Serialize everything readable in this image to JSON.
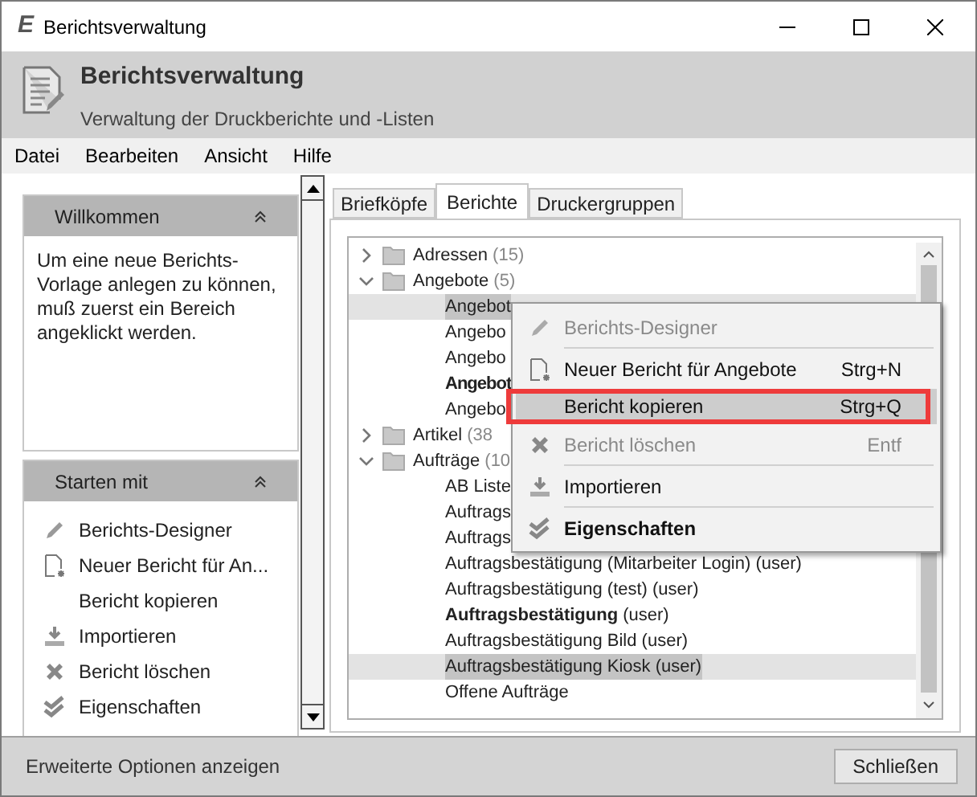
{
  "window": {
    "logo": "E",
    "title": "Berichtsverwaltung"
  },
  "header": {
    "title": "Berichtsverwaltung",
    "subtitle": "Verwaltung der Druckberichte und -Listen"
  },
  "menu_bar": [
    "Datei",
    "Bearbeiten",
    "Ansicht",
    "Hilfe"
  ],
  "sidebar": {
    "welcome": {
      "title": "Willkommen",
      "text": "Um eine neue Berichts-Vorlage anlegen zu können, muß zuerst ein Bereich angeklickt werden."
    },
    "start": {
      "title": "Starten mit",
      "items": [
        {
          "label": "Berichts-Designer"
        },
        {
          "label": "Neuer Bericht für An..."
        },
        {
          "label": "Bericht kopieren"
        },
        {
          "label": "Importieren"
        },
        {
          "label": "Bericht löschen"
        },
        {
          "label": "Eigenschaften"
        }
      ]
    }
  },
  "tabs": [
    {
      "label": "Briefköpfe",
      "selected": false
    },
    {
      "label": "Berichte",
      "selected": true
    },
    {
      "label": "Druckergruppen",
      "selected": false
    }
  ],
  "tree": [
    {
      "label": "Adressen",
      "count": "(15)",
      "expanded": false
    },
    {
      "label": "Angebote",
      "count": "(5)",
      "expanded": true,
      "children": [
        {
          "label": "Angebot",
          "selected": true,
          "bold": false
        },
        {
          "label": "Angebo",
          "selected": false,
          "bold": false
        },
        {
          "label": "Angebo",
          "selected": false,
          "bold": false
        },
        {
          "label": "Angebot",
          "selected": false,
          "bold": true
        },
        {
          "label": "Angebo",
          "selected": false,
          "bold": false
        }
      ]
    },
    {
      "label": "Artikel",
      "count": "(38",
      "expanded": false
    },
    {
      "label": "Aufträge",
      "count": "(10",
      "expanded": true,
      "children": [
        {
          "label": "AB Liste",
          "selected": false,
          "bold": false
        },
        {
          "label": "Auftrags",
          "selected": false,
          "bold": false
        },
        {
          "label": "Auftrags",
          "selected": false,
          "bold": false
        },
        {
          "label": "Auftragsbestätigung (Mitarbeiter Login) (user)",
          "selected": false,
          "bold": false
        },
        {
          "label": "Auftragsbestätigung (test) (user)",
          "selected": false,
          "bold": false
        },
        {
          "label": "**Auftragsbestätigung** (user)",
          "selected": false,
          "bold": false
        },
        {
          "label": "Auftragsbestätigung Bild (user)",
          "selected": false,
          "bold": false
        },
        {
          "label": "Auftragsbestätigung Kiosk (user)",
          "selected": true,
          "bold": false
        },
        {
          "label": "Offene Aufträge",
          "selected": false,
          "bold": false
        }
      ]
    }
  ],
  "context_menu": [
    {
      "label": "Berichts-Designer",
      "disabled": true,
      "selected": false,
      "bold": false
    },
    {
      "label": "Neuer Bericht für Angebote",
      "shortcut": "Strg+N",
      "disabled": false,
      "selected": false,
      "bold": false
    },
    {
      "label": "Bericht kopieren",
      "shortcut": "Strg+Q",
      "disabled": false,
      "selected": true,
      "bold": false
    },
    {
      "label": "Bericht löschen",
      "shortcut": "Entf",
      "disabled": true,
      "selected": false,
      "bold": false
    },
    {
      "label": "Importieren",
      "disabled": false,
      "selected": false,
      "bold": false
    },
    {
      "label": "Eigenschaften",
      "disabled": false,
      "selected": false,
      "bold": true
    }
  ],
  "footer": {
    "link": "Erweiterte Optionen anzeigen",
    "close_button": "Schließen"
  }
}
